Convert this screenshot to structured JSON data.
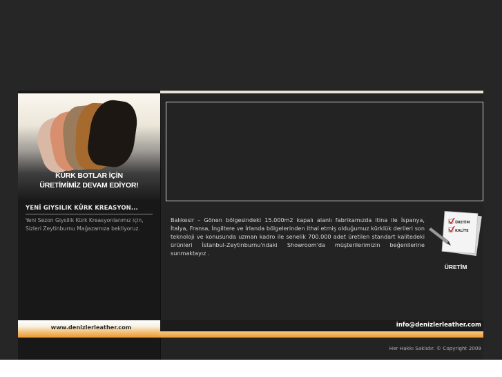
{
  "promo": {
    "line1": "KÜRK BOTLAR İÇİN",
    "line2": "ÜRETİMİMİZ DEVAM EDİYOR!"
  },
  "news": {
    "title": "YENİ GIYSILIK KÜRK KREASYON...",
    "body": "Yeni Sezon Giysilik Kürk Kreasyonlarımız için, Sizleri Zeytinburnu Mağazamıza bekliyoruz."
  },
  "about": {
    "text": "Balıkesir – Gönen bölgesindeki 15.000m2 kapalı alanlı fabrikamızda itina ile İspanya, İtalya, Fransa, İngiltere ve İrlanda bölgelerinden ithal etmiş olduğumuz kürklük derileri son teknoloji ve konusunda uzman kadro ile senelik 700.000 adet üretilen standart kalitedeki ürünleri İstanbul-Zeytinburnu'ndaki Showroom'da müşterilerimizin beğenilerine sunmaktayız ."
  },
  "production": {
    "label": "ÜRETİM",
    "checklist": [
      "ÜRETİM",
      "KALİTE"
    ]
  },
  "footer": {
    "site_url": "www.denizlerleather.com",
    "email": "info@denizlerleather.com",
    "copyright": "Her Hakkı Saklıdır. © Copyright 2009"
  },
  "colors": {
    "accent": "#ef9a2e",
    "background": "#262626",
    "panel": "#232323"
  }
}
